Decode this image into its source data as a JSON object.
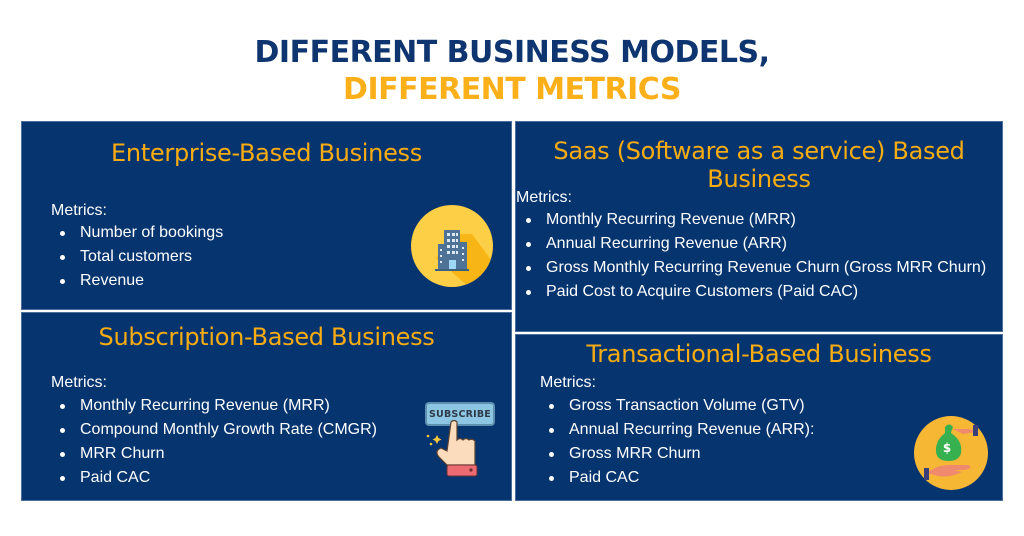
{
  "title": {
    "line1": "DIFFERENT BUSINESS MODELS,",
    "line2": "DIFFERENT METRICS",
    "line1_color": "#0e3570",
    "line2_color": "#fbb01a"
  },
  "colors": {
    "panel_bg": "#05346f",
    "panel_heading": "#f8ac12",
    "text": "#ffffff"
  },
  "panels": {
    "enterprise": {
      "heading": "Enterprise-Based Business",
      "metrics_label": "Metrics:",
      "metrics": [
        "Number of bookings",
        "Total customers",
        "Revenue"
      ],
      "icon": "office-building-icon"
    },
    "saas": {
      "heading": "Saas (Software as a service) Based Business",
      "metrics_label": "Metrics:",
      "metrics": [
        "Monthly Recurring Revenue (MRR)",
        "Annual Recurring Revenue (ARR)",
        "Gross Monthly Recurring Revenue Churn (Gross MRR Churn)",
        "Paid Cost to Acquire Customers (Paid CAC)"
      ]
    },
    "subscription": {
      "heading": "Subscription-Based Business",
      "metrics_label": "Metrics:",
      "metrics": [
        "Monthly Recurring Revenue (MRR)",
        "Compound Monthly Growth Rate (CMGR)",
        "MRR Churn",
        "Paid CAC"
      ],
      "icon": "subscribe-button-icon",
      "icon_label": "SUBSCRIBE"
    },
    "transactional": {
      "heading": "Transactional-Based Business",
      "metrics_label": "Metrics:",
      "metrics": [
        "Gross Transaction Volume (GTV)",
        "Annual Recurring Revenue (ARR):",
        "Gross MRR Churn",
        "Paid CAC"
      ],
      "icon": "money-bag-exchange-icon",
      "icon_symbol": "$"
    }
  }
}
